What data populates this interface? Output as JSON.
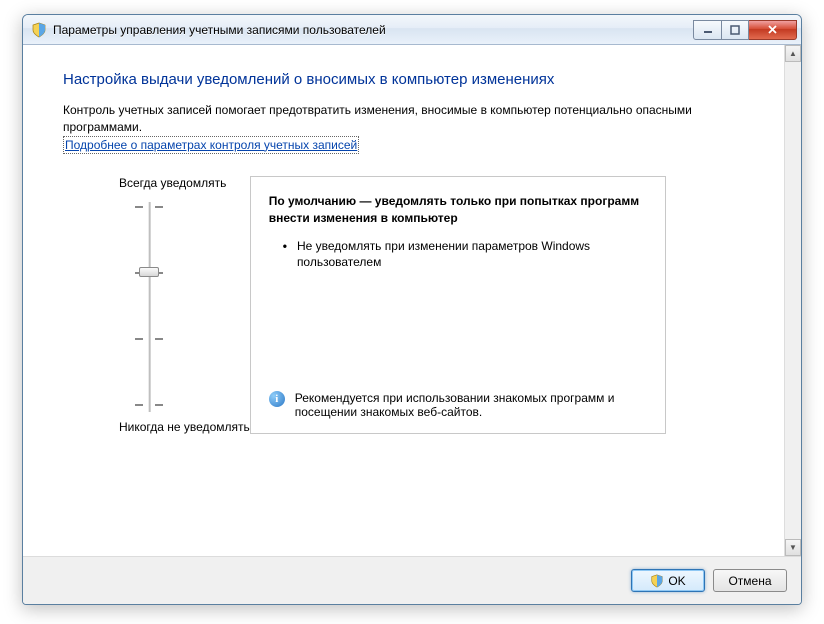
{
  "window": {
    "title": "Параметры управления учетными записями пользователей"
  },
  "content": {
    "heading": "Настройка выдачи уведомлений о вносимых в компьютер изменениях",
    "description": "Контроль учетных записей помогает предотвратить изменения, вносимые в компьютер потенциально опасными программами.",
    "link_text": "Подробнее о параметрах контроля учетных записей"
  },
  "slider": {
    "top_label": "Всегда уведомлять",
    "bottom_label": "Никогда не уведомлять",
    "level": 2,
    "levels": 4
  },
  "panel": {
    "title_line": "По умолчанию — уведомлять только при попытках программ внести изменения в компьютер",
    "bullet": "Не уведомлять при изменении параметров Windows пользователем",
    "recommendation": "Рекомендуется при использовании знакомых программ и посещении знакомых веб-сайтов."
  },
  "buttons": {
    "ok": "OK",
    "cancel": "Отмена"
  }
}
